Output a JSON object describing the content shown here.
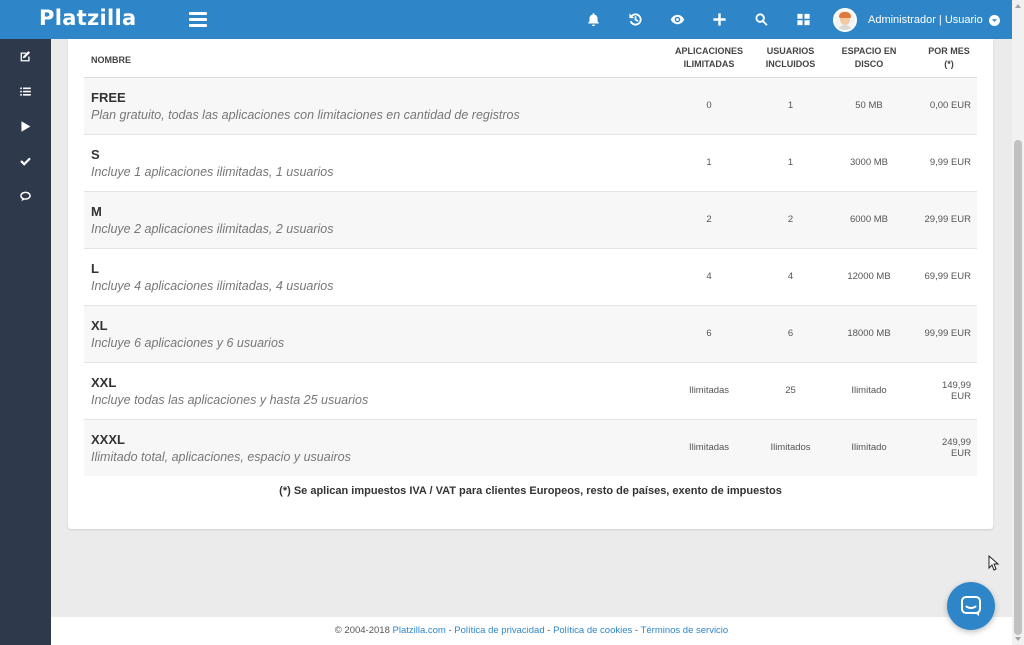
{
  "app": {
    "logo": "Platzilla"
  },
  "topbar": {
    "icons": [
      "bell-icon",
      "history-icon",
      "eye-icon",
      "plus-icon",
      "search-icon",
      "grid-icon"
    ],
    "user_label": "Administrador | Usuario"
  },
  "sidebar": {
    "items": [
      {
        "icon": "edit-icon"
      },
      {
        "icon": "list-icon"
      },
      {
        "icon": "play-icon"
      },
      {
        "icon": "check-icon"
      },
      {
        "icon": "chat-icon"
      }
    ]
  },
  "table": {
    "headers": {
      "name": "NOMBRE",
      "apps": [
        "APLICACIONES",
        "ILIMITADAS"
      ],
      "users": [
        "USUARIOS",
        "INCLUIDOS"
      ],
      "disk": [
        "ESPACIO EN",
        "DISCO"
      ],
      "price": [
        "POR MES",
        "(*)"
      ]
    },
    "rows": [
      {
        "name": "FREE",
        "desc": "Plan gratuito, todas las aplicaciones con limitaciones en cantidad de registros",
        "apps": "0",
        "users": "1",
        "disk": "50 MB",
        "price": "0,00 EUR"
      },
      {
        "name": "S",
        "desc": "Incluye 1 aplicaciones ilimitadas, 1 usuarios",
        "apps": "1",
        "users": "1",
        "disk": "3000 MB",
        "price": "9,99 EUR"
      },
      {
        "name": "M",
        "desc": "Incluye 2 aplicaciones ilimitadas, 2 usuarios",
        "apps": "2",
        "users": "2",
        "disk": "6000 MB",
        "price": "29,99 EUR"
      },
      {
        "name": "L",
        "desc": "Incluye 4 aplicaciones ilimitadas, 4 usuarios",
        "apps": "4",
        "users": "4",
        "disk": "12000 MB",
        "price": "69,99 EUR"
      },
      {
        "name": "XL",
        "desc": "Incluye 6 aplicaciones y 6 usuarios",
        "apps": "6",
        "users": "6",
        "disk": "18000 MB",
        "price": "99,99 EUR"
      },
      {
        "name": "XXL",
        "desc": "Incluye todas las aplicaciones y hasta 25 usuarios",
        "apps": "Ilimitadas",
        "users": "25",
        "disk": "Ilimitado",
        "price": "149,99 EUR"
      },
      {
        "name": "XXXL",
        "desc": "Ilimitado total, aplicaciones, espacio y usuairos",
        "apps": "Ilimitadas",
        "users": "Ilimitados",
        "disk": "Ilimitado",
        "price": "249,99 EUR"
      }
    ],
    "footnote": "(*) Se aplican impuestos IVA / VAT para clientes Europeos, resto de países, exento de impuestos"
  },
  "footer": {
    "copyright": "© 2004-2018 ",
    "site": "Platzilla.com",
    "sep": " - ",
    "privacy": "Política de privacidad",
    "cookies": "Política de cookies",
    "terms": "Términos de servicio"
  },
  "colors": {
    "accent": "#2e86c9",
    "sidebar": "#2e3a4b"
  }
}
